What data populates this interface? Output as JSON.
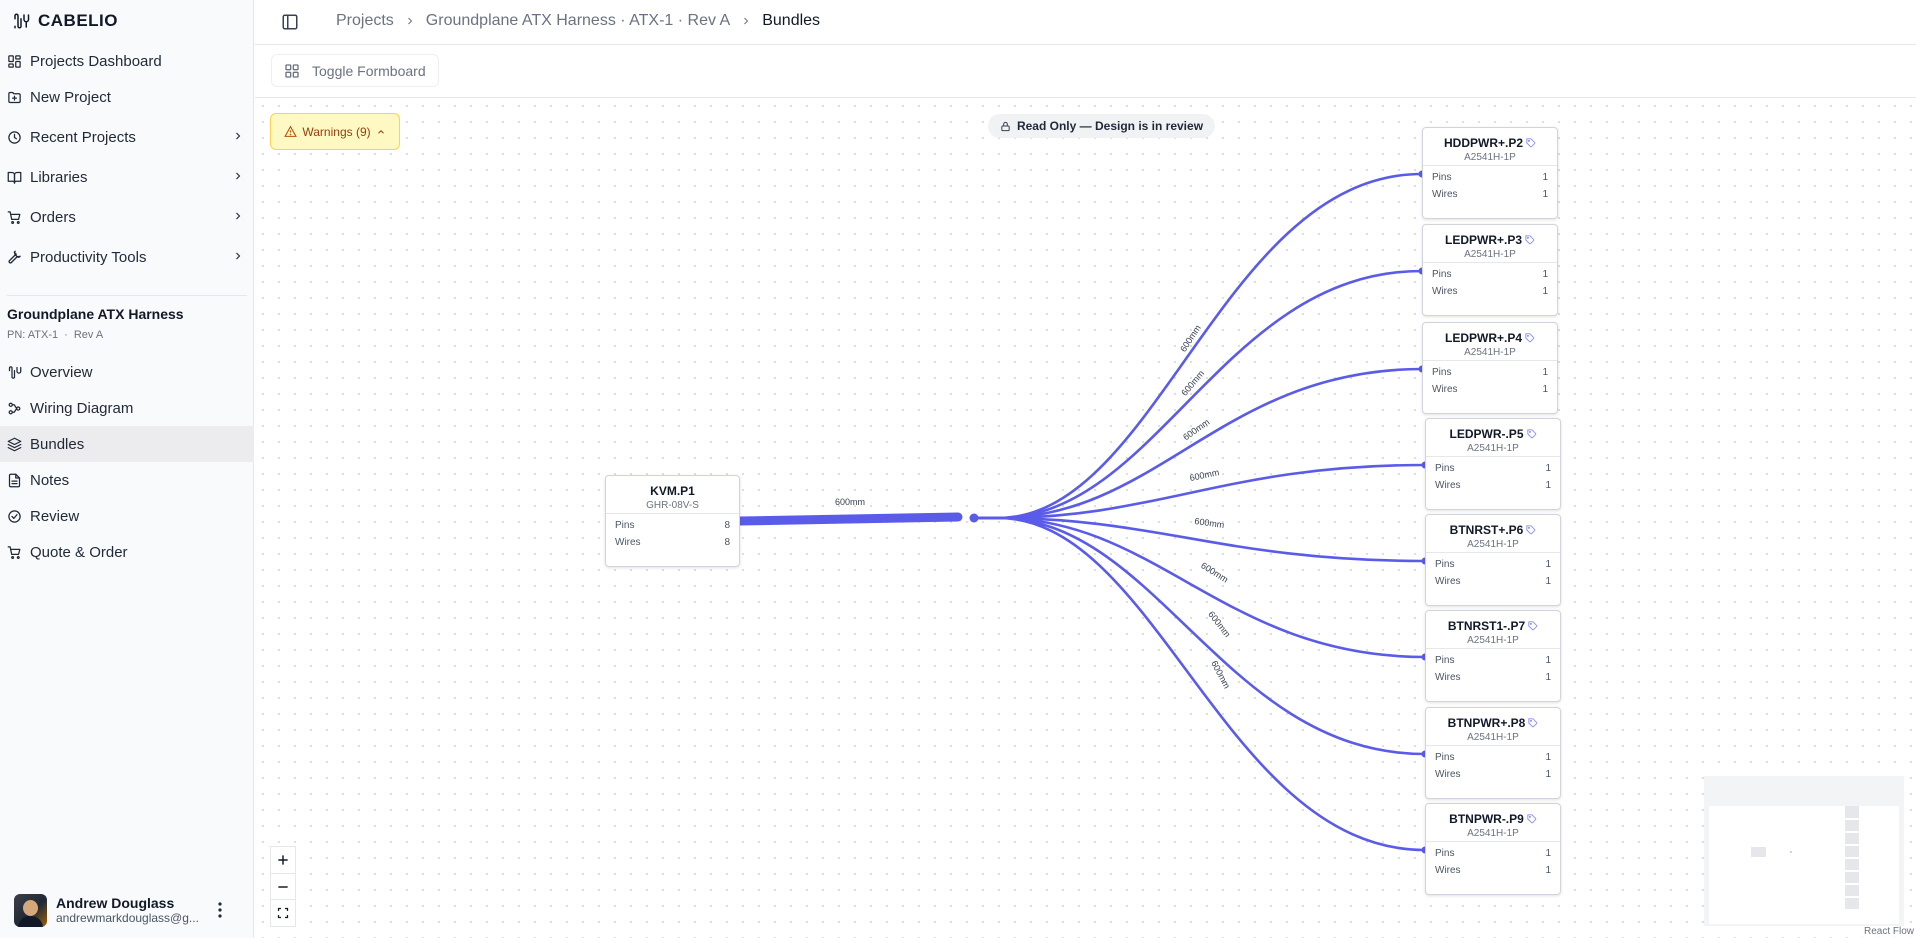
{
  "brand": "CABELIO",
  "nav": {
    "top": [
      {
        "label": "Projects Dashboard",
        "icon": "dashboard-icon",
        "chevron": false
      },
      {
        "label": "New Project",
        "icon": "folder-plus-icon",
        "chevron": false
      },
      {
        "label": "Recent Projects",
        "icon": "clock-icon",
        "chevron": true
      },
      {
        "label": "Libraries",
        "icon": "book-icon",
        "chevron": true
      },
      {
        "label": "Orders",
        "icon": "cart-icon",
        "chevron": true
      },
      {
        "label": "Productivity Tools",
        "icon": "wrench-icon",
        "chevron": true
      }
    ],
    "project": {
      "title": "Groundplane ATX Harness",
      "pn": "PN: ATX-1",
      "sep": "·",
      "rev": "Rev A"
    },
    "project_items": [
      {
        "label": "Overview",
        "icon": "overview-icon"
      },
      {
        "label": "Wiring Diagram",
        "icon": "wiring-icon"
      },
      {
        "label": "Bundles",
        "icon": "layers-icon",
        "active": true
      },
      {
        "label": "Notes",
        "icon": "notes-icon"
      },
      {
        "label": "Review",
        "icon": "check-circle-icon"
      },
      {
        "label": "Quote & Order",
        "icon": "cart-icon"
      }
    ]
  },
  "user": {
    "name": "Andrew Douglass",
    "email": "andrewmarkdouglass@g..."
  },
  "breadcrumb": {
    "projects": "Projects",
    "project": "Groundplane ATX Harness · ATX-1 · Rev A",
    "current": "Bundles"
  },
  "toolbar": {
    "toggle_label": "Toggle Formboard"
  },
  "canvas": {
    "warnings": "Warnings (9)",
    "readonly": "Read Only — Design is in review",
    "attribution": "React Flow",
    "pins_label": "Pins",
    "wires_label": "Wires",
    "trunk_label": "600mm",
    "source": {
      "name": "KVM.P1",
      "part": "GHR-08V-S",
      "pins": "8",
      "wires": "8"
    },
    "targets": [
      {
        "name": "HDDPWR+.P2",
        "part": "A2541H-1P",
        "pins": "1",
        "wires": "1",
        "edge_label": ""
      },
      {
        "name": "LEDPWR+.P3",
        "part": "A2541H-1P",
        "pins": "1",
        "wires": "1",
        "edge_label": "600mm"
      },
      {
        "name": "LEDPWR+.P4",
        "part": "A2541H-1P",
        "pins": "1",
        "wires": "1",
        "edge_label": "600mm"
      },
      {
        "name": "LEDPWR-.P5",
        "part": "A2541H-1P",
        "pins": "1",
        "wires": "1",
        "edge_label": "600mm"
      },
      {
        "name": "BTNRST+.P6",
        "part": "A2541H-1P",
        "pins": "1",
        "wires": "1",
        "edge_label": "600mm"
      },
      {
        "name": "BTNRST1-.P7",
        "part": "A2541H-1P",
        "pins": "1",
        "wires": "1",
        "edge_label": "600mm"
      },
      {
        "name": "BTNPWR+.P8",
        "part": "A2541H-1P",
        "pins": "1",
        "wires": "1",
        "edge_label": "600mm"
      },
      {
        "name": "BTNPWR-.P9",
        "part": "A2541H-1P",
        "pins": "1",
        "wires": "1",
        "edge_label": "600mm"
      }
    ],
    "extra_label": "600mm",
    "edge_color": "#5b5bea"
  }
}
